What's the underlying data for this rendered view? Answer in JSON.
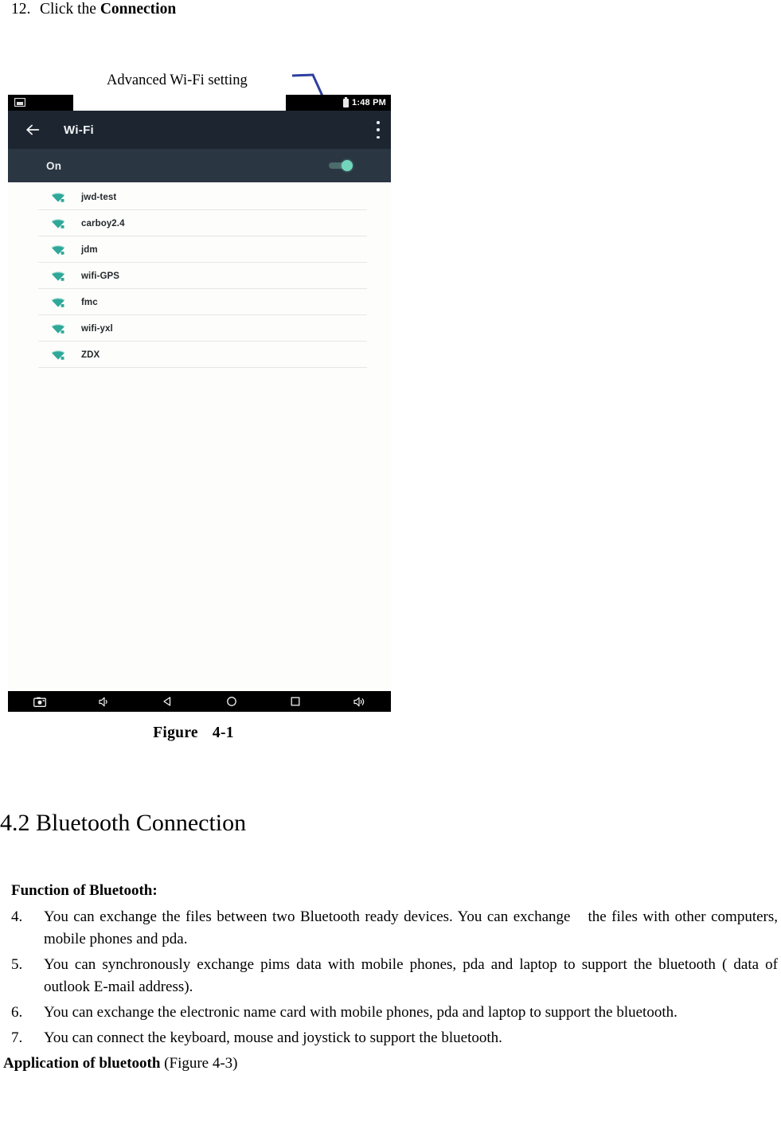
{
  "step": {
    "number": "12.",
    "text_prefix": "Click the ",
    "text_bold": "Connection"
  },
  "callout": {
    "label": "Advanced Wi-Fi setting",
    "line_color": "#2f3f9e"
  },
  "device_screenshot": {
    "status_bar": {
      "notification_icon": "screenshot-icon",
      "time": "1:48 PM",
      "battery_icon": "battery-icon"
    },
    "app_bar": {
      "back_icon": "back-arrow-icon",
      "title": "Wi-Fi",
      "overflow_icon": "overflow-menu-icon"
    },
    "toggle_row": {
      "label": "On",
      "switch_state": "on",
      "switch_color": "#72d6bd"
    },
    "networks": [
      {
        "name": "jwd-test",
        "icon": "wifi-secured-icon"
      },
      {
        "name": "carboy2.4",
        "icon": "wifi-secured-icon"
      },
      {
        "name": "jdm",
        "icon": "wifi-secured-icon"
      },
      {
        "name": "wifi-GPS",
        "icon": "wifi-secured-icon"
      },
      {
        "name": "fmc",
        "icon": "wifi-secured-icon"
      },
      {
        "name": "wifi-yxl",
        "icon": "wifi-secured-icon"
      },
      {
        "name": "ZDX",
        "icon": "wifi-secured-icon"
      }
    ],
    "nav_bar": [
      {
        "icon": "screenshot-camera-icon"
      },
      {
        "icon": "volume-down-icon"
      },
      {
        "icon": "back-triangle-icon"
      },
      {
        "icon": "home-circle-icon"
      },
      {
        "icon": "recents-square-icon"
      },
      {
        "icon": "volume-up-icon"
      }
    ]
  },
  "figure": {
    "label": "Figure",
    "number": "4-1"
  },
  "section": {
    "heading": "4.2 Bluetooth Connection",
    "function_title": "Function of Bluetooth:",
    "items": [
      {
        "number": "4.",
        "text_a": "You can exchange the files between two Bluetooth ready devices. You can exchange",
        "text_b": "the files with other computers, mobile phones and pda."
      },
      {
        "number": "5.",
        "text_a": "You can synchronously exchange pims data with mobile phones, pda and laptop to support the bluetooth ( data of outlook E-mail address).",
        "text_b": ""
      },
      {
        "number": "6.",
        "text_a": "You can exchange the electronic name card with mobile phones, pda and laptop to support the bluetooth.",
        "text_b": ""
      },
      {
        "number": "7.",
        "text_a": "You can connect the keyboard, mouse and joystick to support the bluetooth.",
        "text_b": ""
      }
    ],
    "application_bold": "Application of bluetooth",
    "application_rest": " (Figure 4-3)"
  }
}
